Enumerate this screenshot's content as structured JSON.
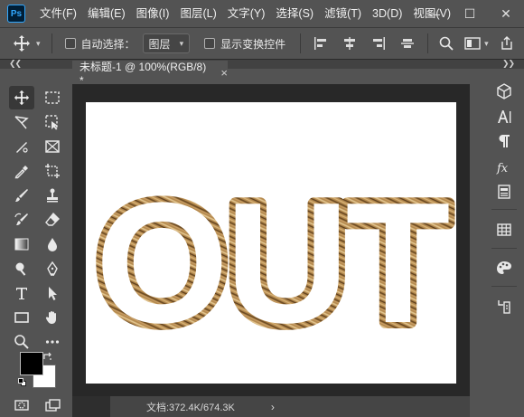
{
  "app": {
    "logo_text": "Ps"
  },
  "menu": [
    "文件(F)",
    "编辑(E)",
    "图像(I)",
    "图层(L)",
    "文字(Y)",
    "选择(S)",
    "滤镜(T)",
    "3D(D)",
    "视图(V)"
  ],
  "window_controls": {
    "minimize": "—",
    "maximize": "☐",
    "close": "✕"
  },
  "options": {
    "auto_select_label": "自动选择：",
    "auto_select_checked": false,
    "auto_select_target": "图层",
    "transform_controls_label": "显示变换控件",
    "transform_controls_checked": false
  },
  "document": {
    "tab_title": "未标题-1 @ 100%(RGB/8) *",
    "close_glyph": "×",
    "canvas_text": "OUT",
    "status_text": "文档:372.4K/674.3K",
    "status_arrow": "›"
  },
  "colors": {
    "ui_bg": "#535353",
    "workspace_bg": "#282828",
    "canvas_bg": "#ffffff",
    "text_fill_light": "#c9a36a",
    "text_fill_dark": "#6b4a22",
    "foreground_color": "#000000",
    "background_color": "#ffffff"
  },
  "tools": [
    "move-tool",
    "marquee-tool",
    "lasso-tool",
    "object-select-tool",
    "healing-tool",
    "frame-tool",
    "eyedropper-tool",
    "crop-tool",
    "brush-tool",
    "stamp-tool",
    "history-brush-tool",
    "eraser-tool",
    "gradient-tool",
    "blur-tool",
    "dodge-tool",
    "pen-tool",
    "type-tool",
    "path-select-tool",
    "shape-tool",
    "hand-tool",
    "zoom-tool",
    "more-tools"
  ],
  "dock_panels": [
    "3d-panel",
    "character-panel",
    "paragraph-panel",
    "glyphs-panel",
    "properties-panel",
    "swatches-panel",
    "adjustments-panel",
    "history-panel"
  ]
}
